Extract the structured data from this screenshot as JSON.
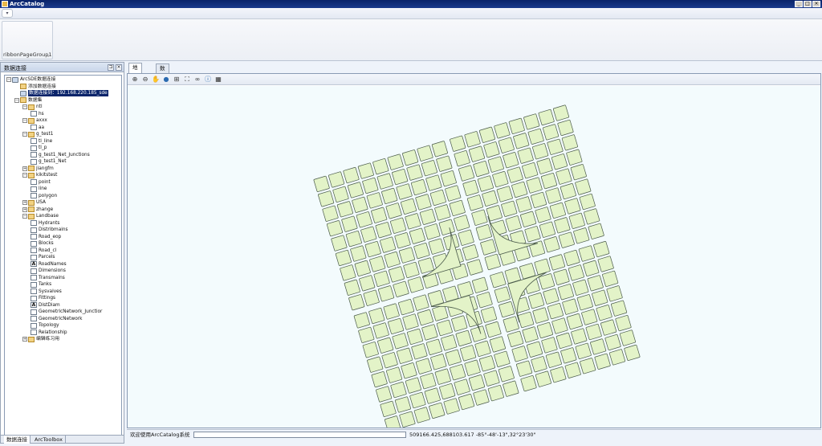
{
  "window": {
    "title": "ArcCatalog"
  },
  "ribbon": {
    "page_group_label": "ribbonPageGroup1"
  },
  "dock": {
    "title": "数据连接",
    "tabs": [
      "数据连接",
      "ArcToolbox"
    ],
    "tree": [
      {
        "label": "ArcSDE数据连接",
        "level": 0,
        "icon": "database-folder-icon"
      },
      {
        "label": "添加数据连接",
        "level": 1,
        "icon": "add-connection-icon"
      },
      {
        "label": "数据连接到：192.168.220.185_sde",
        "level": 1,
        "icon": "sde-connection-icon",
        "selected": true
      },
      {
        "label": "数据集",
        "level": 2,
        "icon": "dataset-icon"
      },
      {
        "label": "ntl",
        "level": 3,
        "icon": "dataset-icon"
      },
      {
        "label": "hs",
        "level": 4,
        "icon": "featureclass-icon"
      },
      {
        "label": "axxx",
        "level": 3,
        "icon": "dataset-icon"
      },
      {
        "label": "aa",
        "level": 4,
        "icon": "featureclass-icon"
      },
      {
        "label": "g_test1",
        "level": 3,
        "icon": "dataset-icon"
      },
      {
        "label": "tl_line",
        "level": 4,
        "icon": "featureclass-icon"
      },
      {
        "label": "tl_p",
        "level": 4,
        "icon": "featureclass-icon"
      },
      {
        "label": "g_test1_Net_Junctions",
        "level": 4,
        "icon": "featureclass-icon"
      },
      {
        "label": "g_test1_Net",
        "level": 4,
        "icon": "network-icon"
      },
      {
        "label": "jiangfm",
        "level": 3,
        "icon": "dataset-icon"
      },
      {
        "label": "kikitstest",
        "level": 3,
        "icon": "dataset-icon"
      },
      {
        "label": "point",
        "level": 4,
        "icon": "featureclass-icon"
      },
      {
        "label": "line",
        "level": 4,
        "icon": "featureclass-icon"
      },
      {
        "label": "polygon",
        "level": 4,
        "icon": "featureclass-icon"
      },
      {
        "label": "USA",
        "level": 3,
        "icon": "dataset-icon"
      },
      {
        "label": "zhange",
        "level": 3,
        "icon": "dataset-icon"
      },
      {
        "label": "Landbase",
        "level": 3,
        "icon": "dataset-icon"
      },
      {
        "label": "Hydrants",
        "level": 4,
        "icon": "featureclass-icon"
      },
      {
        "label": "Distribmains",
        "level": 4,
        "icon": "featureclass-icon"
      },
      {
        "label": "Road_eop",
        "level": 4,
        "icon": "featureclass-icon"
      },
      {
        "label": "Blocks",
        "level": 4,
        "icon": "featureclass-icon"
      },
      {
        "label": "Road_cl",
        "level": 4,
        "icon": "featureclass-icon"
      },
      {
        "label": "Parcels",
        "level": 4,
        "icon": "featureclass-icon"
      },
      {
        "label": "RoadNames",
        "level": 4,
        "icon": "annotation-icon"
      },
      {
        "label": "Dimensions",
        "level": 4,
        "icon": "featureclass-icon"
      },
      {
        "label": "Transmains",
        "level": 4,
        "icon": "featureclass-icon"
      },
      {
        "label": "Tanks",
        "level": 4,
        "icon": "featureclass-icon"
      },
      {
        "label": "Sysvalves",
        "level": 4,
        "icon": "featureclass-icon"
      },
      {
        "label": "Fittings",
        "level": 4,
        "icon": "featureclass-icon"
      },
      {
        "label": "DistDiam",
        "level": 4,
        "icon": "annotation-icon"
      },
      {
        "label": "GeometricNetwork_Junctior",
        "level": 4,
        "icon": "featureclass-icon"
      },
      {
        "label": "GeometricNetwork",
        "level": 4,
        "icon": "network-icon"
      },
      {
        "label": "Topology",
        "level": 4,
        "icon": "topology-icon"
      },
      {
        "label": "Relationship",
        "level": 4,
        "icon": "relationship-icon"
      },
      {
        "label": "编辑练习用",
        "level": 3,
        "icon": "dataset-icon"
      }
    ]
  },
  "main": {
    "tabs": [
      "地图视窗",
      "数据视窗"
    ],
    "toolbar": [
      "zoom-in-icon",
      "zoom-out-icon",
      "pan-icon",
      "globe-icon",
      "full-extent-icon",
      "fixed-zoom-icon",
      "binoculars-icon",
      "identify-icon",
      "grid-icon"
    ],
    "status_text": "欢迎使用ArcCatalog系统",
    "coordinates": "509166.425,688103.617  -85°-48'-13\",32°23'30\""
  },
  "colors": {
    "parcel_fill": "#e3f3c8",
    "parcel_stroke": "#4a5a4a",
    "map_bg": "#f3fbfd"
  }
}
